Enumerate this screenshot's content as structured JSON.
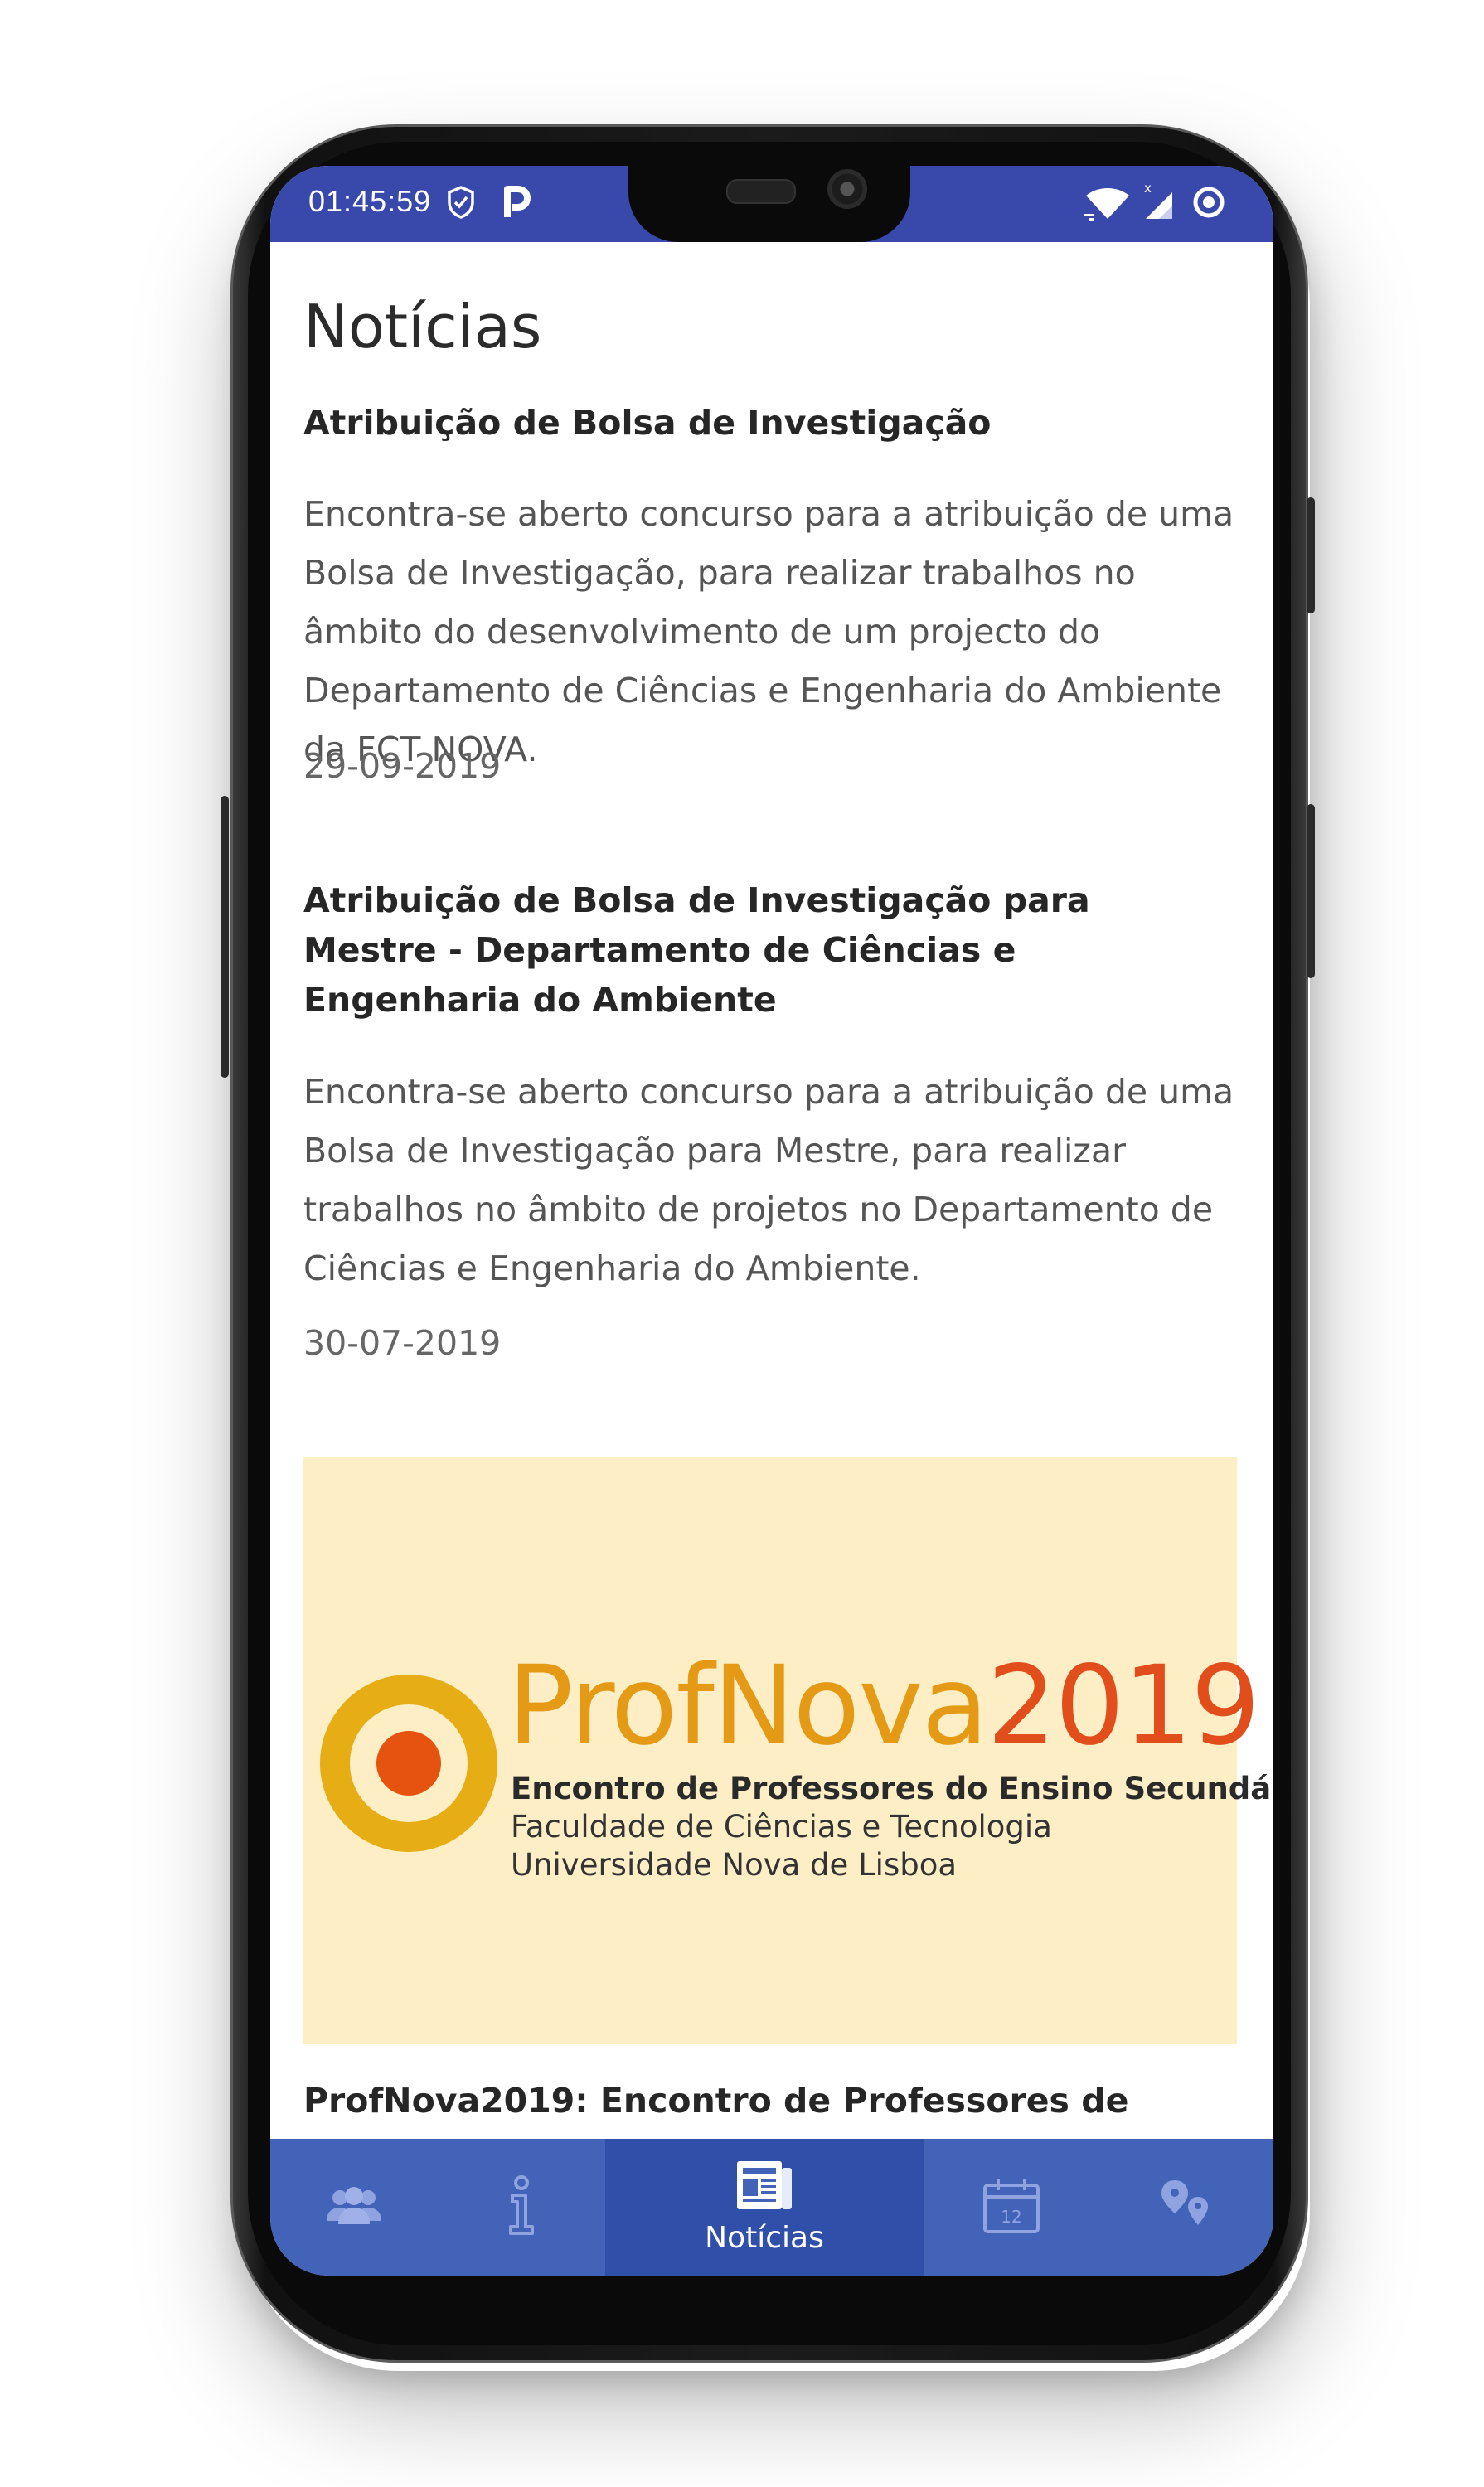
{
  "status_bar": {
    "time": "01:45:59"
  },
  "page": {
    "title": "Notícias"
  },
  "news": [
    {
      "title": "Atribuição de Bolsa de Investigação",
      "body": "Encontra-se aberto concurso para a atribuição de uma Bolsa de Investigação, para realizar trabalhos no âmbito do desenvolvimento de um projecto do Departamento de Ciências e Engenharia do Ambiente da FCT NOVA.",
      "date": "29-09-2019"
    },
    {
      "title": "Atribuição de Bolsa de Investigação para Mestre - Departamento de Ciências e Engenharia do Ambiente",
      "body": "Encontra-se aberto concurso para a atribuição de uma Bolsa de Investigação para Mestre, para realizar trabalhos no âmbito de projetos no Departamento de Ciências e Engenharia do Ambiente.",
      "date": "30-07-2019"
    },
    {
      "title": "ProfNova2019: Encontro de Professores de",
      "banner": {
        "brand": "ProfNova",
        "year": "2019",
        "line1": "Encontro de Professores do Ensino Secundário",
        "line2": "Faculdade de Ciências e Tecnologia",
        "line3": "Universidade Nova de Lisboa"
      }
    }
  ],
  "bottom_nav": {
    "items": [
      {
        "icon": "people-icon",
        "label": ""
      },
      {
        "icon": "info-icon",
        "label": ""
      },
      {
        "icon": "newspaper-icon",
        "label": "Notícias",
        "active": true
      },
      {
        "icon": "calendar-icon",
        "label": "",
        "calendar_day": "12"
      },
      {
        "icon": "location-pins-icon",
        "label": ""
      }
    ]
  },
  "colors": {
    "primary": "#3949ab",
    "nav": "#4263b8",
    "nav_active": "#2f4fa8",
    "banner_bg": "#fdeec6",
    "brand_orange": "#e59a16",
    "brand_red": "#e24e1b"
  }
}
